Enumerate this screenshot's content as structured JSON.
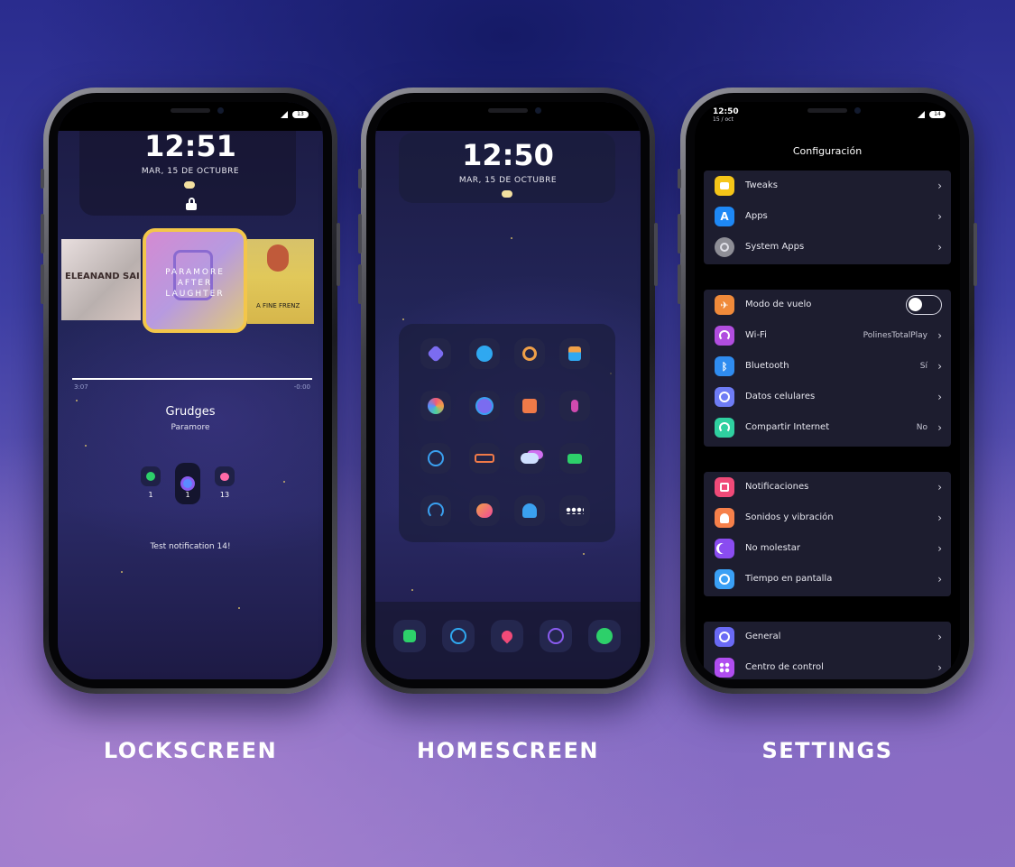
{
  "labels": {
    "lock": "LOCKSCREEN",
    "home": "HOMESCREEN",
    "settings": "SETTINGS"
  },
  "lockscreen": {
    "time": "12:51",
    "date": "MAR, 15 DE OCTUBRE",
    "track_elapsed": "3:07",
    "track_remaining": "-0:00",
    "track_progress": 1.0,
    "song_title": "Grudges",
    "artist": "Paramore",
    "album_text": [
      "PARAMORE",
      "AFTER",
      "LAUGHTER"
    ],
    "left_album_text": "ELEANAND SAI",
    "right_album_text": "A FINE FRENZ",
    "notification_counts": [
      "1",
      "1",
      "13"
    ],
    "notification_text": "Test notification 14!",
    "battery": "13"
  },
  "homescreen": {
    "time": "12:50",
    "date": "MAR, 15 DE OCTUBRE"
  },
  "settings": {
    "status_time": "12:50",
    "status_date": "15 / oct",
    "battery": "14",
    "title": "Configuración",
    "group1": [
      {
        "label": "Tweaks",
        "icon": "tweaks-icon",
        "color": "#f5c518"
      },
      {
        "label": "Apps",
        "icon": "app-store-icon",
        "color": "#1e88f5"
      },
      {
        "label": "System Apps",
        "icon": "gear-icon",
        "color": "#8e8e96"
      }
    ],
    "group2": [
      {
        "label": "Modo de vuelo",
        "icon": "airplane-icon",
        "color": "#f08a3a",
        "toggle": false
      },
      {
        "label": "Wi-Fi",
        "icon": "wifi-icon",
        "color": "#b14ddf",
        "value": "PolinesTotalPlay"
      },
      {
        "label": "Bluetooth",
        "icon": "bluetooth-icon",
        "color": "#2f8cf0",
        "value": "Sí"
      },
      {
        "label": "Datos celulares",
        "icon": "cellular-icon",
        "color": "#6e7cf5",
        "value": ""
      },
      {
        "label": "Compartir Internet",
        "icon": "hotspot-icon",
        "color": "#2fd0a0",
        "value": "No"
      }
    ],
    "group3": [
      {
        "label": "Notificaciones",
        "icon": "notifications-icon",
        "color": "#f04a78"
      },
      {
        "label": "Sonidos y vibración",
        "icon": "sounds-icon",
        "color": "#f6804a"
      },
      {
        "label": "No molestar",
        "icon": "moon-icon",
        "color": "#8a4cf0"
      },
      {
        "label": "Tiempo en pantalla",
        "icon": "screen-time-icon",
        "color": "#3aa0f5"
      }
    ],
    "group4": [
      {
        "label": "General",
        "icon": "general-gear-icon",
        "color": "#6a6af5"
      },
      {
        "label": "Centro de control",
        "icon": "control-center-icon",
        "color": "#b04df0"
      }
    ]
  }
}
